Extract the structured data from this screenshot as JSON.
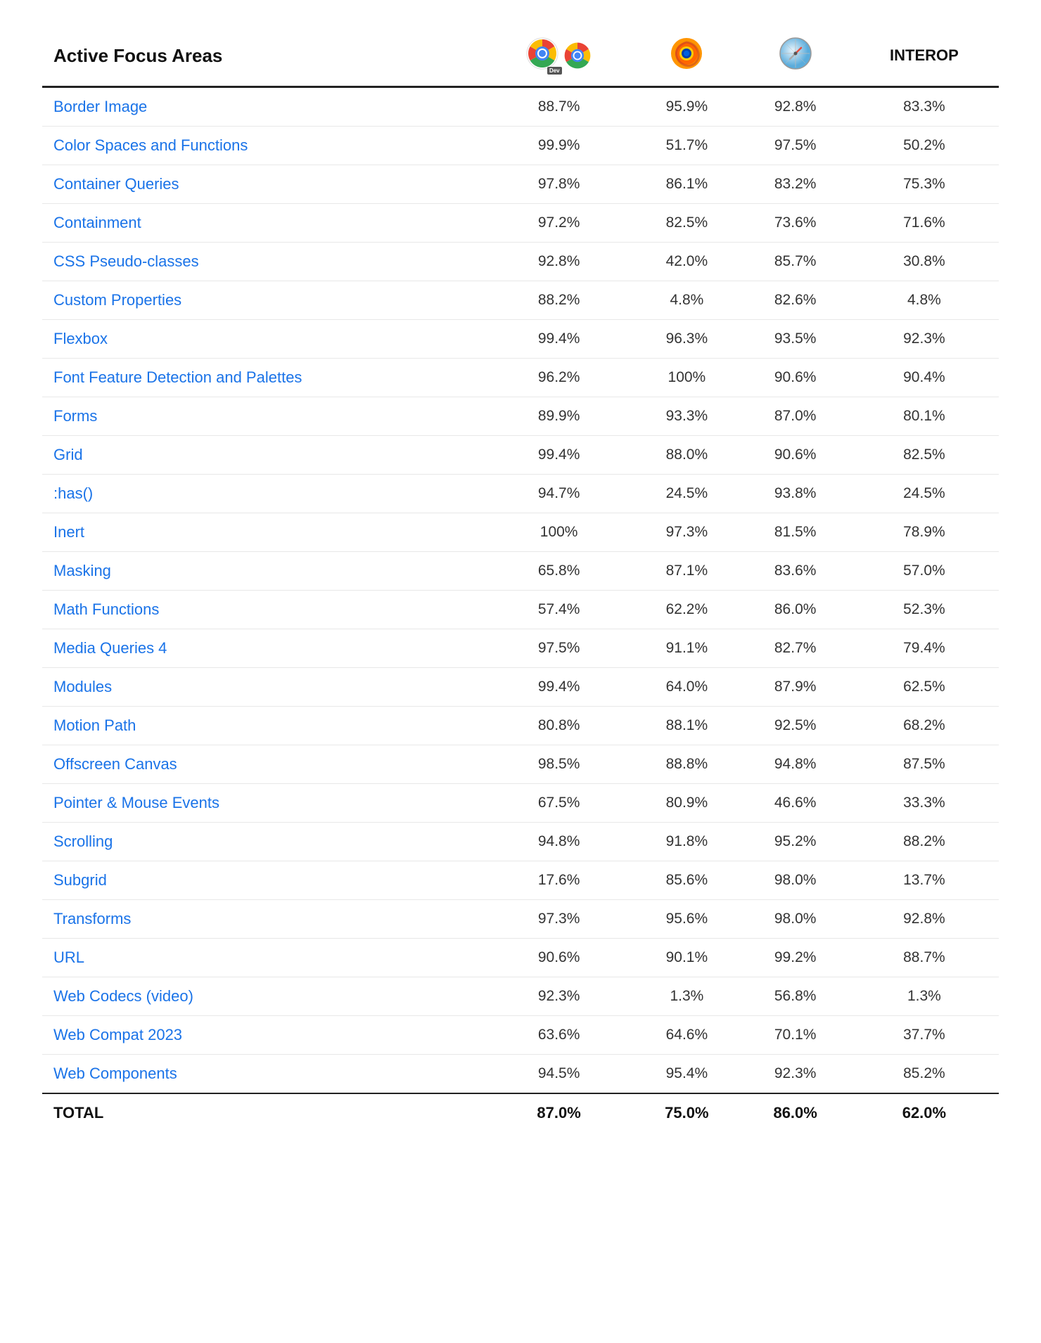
{
  "header": {
    "name_col": "Active Focus Areas",
    "interop_label": "INTEROP"
  },
  "rows": [
    {
      "name": "Border Image",
      "chrome_dev": "88.7%",
      "firefox": "95.9%",
      "safari": "92.8%",
      "interop": "83.3%"
    },
    {
      "name": "Color Spaces and Functions",
      "chrome_dev": "99.9%",
      "firefox": "51.7%",
      "safari": "97.5%",
      "interop": "50.2%"
    },
    {
      "name": "Container Queries",
      "chrome_dev": "97.8%",
      "firefox": "86.1%",
      "safari": "83.2%",
      "interop": "75.3%"
    },
    {
      "name": "Containment",
      "chrome_dev": "97.2%",
      "firefox": "82.5%",
      "safari": "73.6%",
      "interop": "71.6%"
    },
    {
      "name": "CSS Pseudo-classes",
      "chrome_dev": "92.8%",
      "firefox": "42.0%",
      "safari": "85.7%",
      "interop": "30.8%"
    },
    {
      "name": "Custom Properties",
      "chrome_dev": "88.2%",
      "firefox": "4.8%",
      "safari": "82.6%",
      "interop": "4.8%"
    },
    {
      "name": "Flexbox",
      "chrome_dev": "99.4%",
      "firefox": "96.3%",
      "safari": "93.5%",
      "interop": "92.3%"
    },
    {
      "name": "Font Feature Detection and Palettes",
      "chrome_dev": "96.2%",
      "firefox": "100%",
      "safari": "90.6%",
      "interop": "90.4%"
    },
    {
      "name": "Forms",
      "chrome_dev": "89.9%",
      "firefox": "93.3%",
      "safari": "87.0%",
      "interop": "80.1%"
    },
    {
      "name": "Grid",
      "chrome_dev": "99.4%",
      "firefox": "88.0%",
      "safari": "90.6%",
      "interop": "82.5%"
    },
    {
      "name": ":has()",
      "chrome_dev": "94.7%",
      "firefox": "24.5%",
      "safari": "93.8%",
      "interop": "24.5%"
    },
    {
      "name": "Inert",
      "chrome_dev": "100%",
      "firefox": "97.3%",
      "safari": "81.5%",
      "interop": "78.9%"
    },
    {
      "name": "Masking",
      "chrome_dev": "65.8%",
      "firefox": "87.1%",
      "safari": "83.6%",
      "interop": "57.0%"
    },
    {
      "name": "Math Functions",
      "chrome_dev": "57.4%",
      "firefox": "62.2%",
      "safari": "86.0%",
      "interop": "52.3%"
    },
    {
      "name": "Media Queries 4",
      "chrome_dev": "97.5%",
      "firefox": "91.1%",
      "safari": "82.7%",
      "interop": "79.4%"
    },
    {
      "name": "Modules",
      "chrome_dev": "99.4%",
      "firefox": "64.0%",
      "safari": "87.9%",
      "interop": "62.5%"
    },
    {
      "name": "Motion Path",
      "chrome_dev": "80.8%",
      "firefox": "88.1%",
      "safari": "92.5%",
      "interop": "68.2%"
    },
    {
      "name": "Offscreen Canvas",
      "chrome_dev": "98.5%",
      "firefox": "88.8%",
      "safari": "94.8%",
      "interop": "87.5%"
    },
    {
      "name": "Pointer & Mouse Events",
      "chrome_dev": "67.5%",
      "firefox": "80.9%",
      "safari": "46.6%",
      "interop": "33.3%"
    },
    {
      "name": "Scrolling",
      "chrome_dev": "94.8%",
      "firefox": "91.8%",
      "safari": "95.2%",
      "interop": "88.2%"
    },
    {
      "name": "Subgrid",
      "chrome_dev": "17.6%",
      "firefox": "85.6%",
      "safari": "98.0%",
      "interop": "13.7%"
    },
    {
      "name": "Transforms",
      "chrome_dev": "97.3%",
      "firefox": "95.6%",
      "safari": "98.0%",
      "interop": "92.8%"
    },
    {
      "name": "URL",
      "chrome_dev": "90.6%",
      "firefox": "90.1%",
      "safari": "99.2%",
      "interop": "88.7%"
    },
    {
      "name": "Web Codecs (video)",
      "chrome_dev": "92.3%",
      "firefox": "1.3%",
      "safari": "56.8%",
      "interop": "1.3%"
    },
    {
      "name": "Web Compat 2023",
      "chrome_dev": "63.6%",
      "firefox": "64.6%",
      "safari": "70.1%",
      "interop": "37.7%"
    },
    {
      "name": "Web Components",
      "chrome_dev": "94.5%",
      "firefox": "95.4%",
      "safari": "92.3%",
      "interop": "85.2%"
    }
  ],
  "total": {
    "name": "TOTAL",
    "chrome_dev": "87.0%",
    "firefox": "75.0%",
    "safari": "86.0%",
    "interop": "62.0%"
  }
}
